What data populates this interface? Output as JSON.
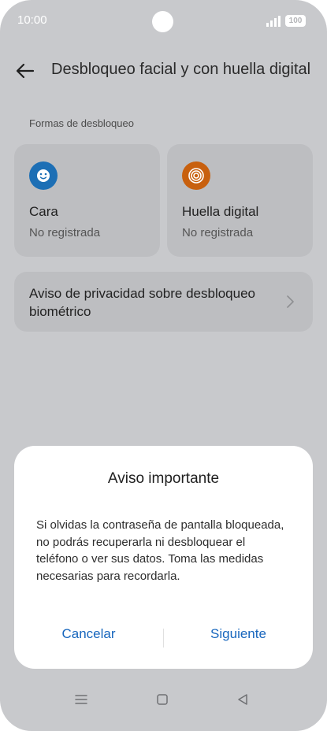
{
  "status_bar": {
    "time": "10:00",
    "battery": "100",
    "icons": [
      "signal-icon",
      "battery-icon"
    ]
  },
  "header": {
    "title": "Desbloqueo facial y con huella digital",
    "back_icon": "back-arrow-icon"
  },
  "section": {
    "label": "Formas de desbloqueo"
  },
  "unlock_methods": [
    {
      "title": "Cara",
      "status": "No registrada",
      "icon": "face-icon",
      "icon_color": "#1d6fb5"
    },
    {
      "title": "Huella digital",
      "status": "No registrada",
      "icon": "fingerprint-icon",
      "icon_color": "#c8600e"
    }
  ],
  "privacy": {
    "label": "Aviso de privacidad sobre desbloqueo biométrico"
  },
  "dialog": {
    "title": "Aviso importante",
    "body": "Si olvidas la contraseña de pantalla bloqueada, no podrás recuperarla ni desbloquear el teléfono o ver sus datos. Toma las medidas necesarias para recordarla.",
    "cancel_label": "Cancelar",
    "next_label": "Siguiente",
    "accent": "#1766bd"
  },
  "nav": {
    "icons": [
      "menu-icon",
      "home-icon",
      "back-triangle-icon"
    ]
  }
}
